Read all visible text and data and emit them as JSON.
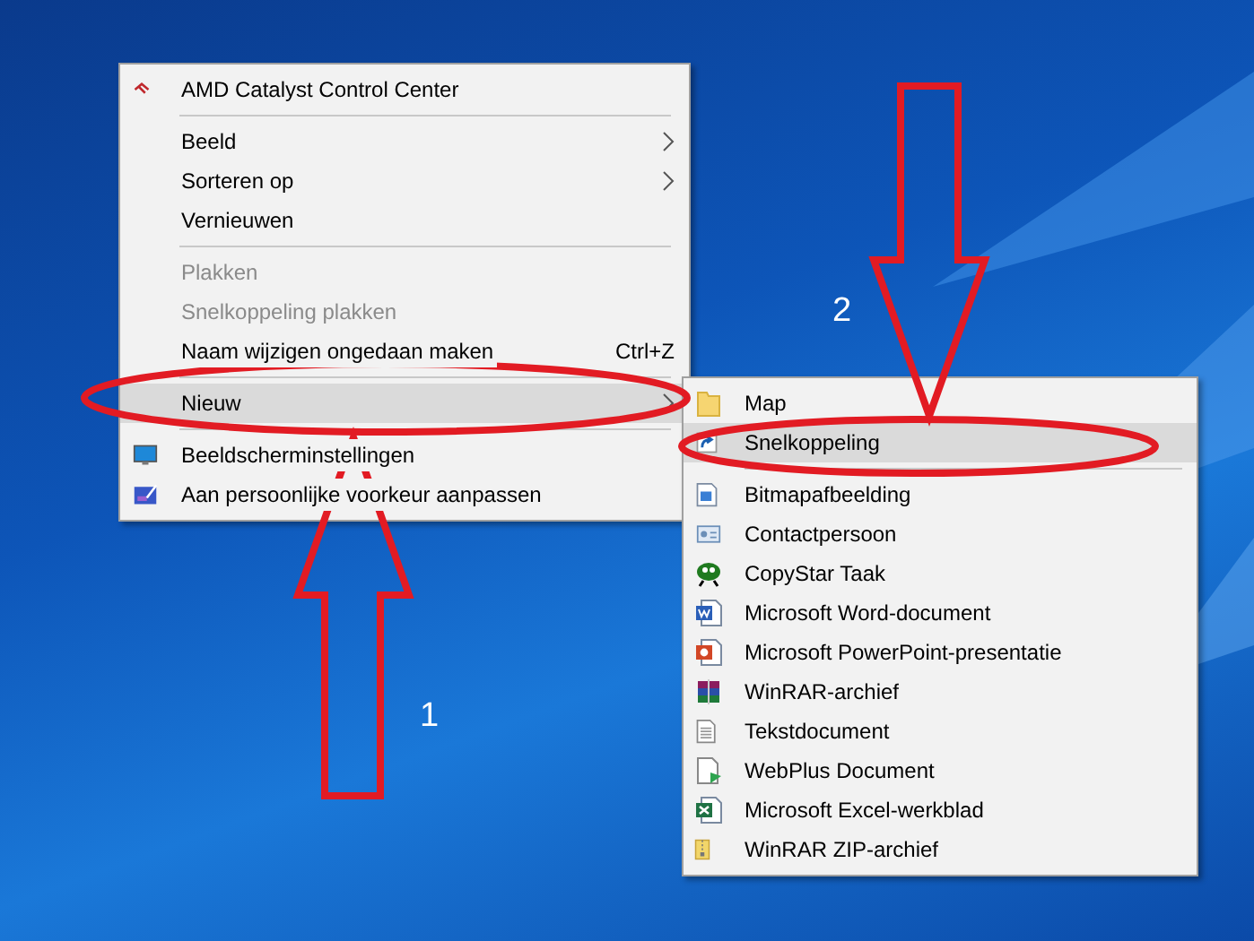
{
  "context_menu": {
    "sections": [
      [
        {
          "label": "AMD Catalyst Control Center",
          "disabled": false,
          "selected": false,
          "has_submenu": false
        }
      ],
      [
        {
          "label": "Beeld",
          "disabled": false,
          "selected": false,
          "has_submenu": true
        },
        {
          "label": "Sorteren op",
          "disabled": false,
          "selected": false,
          "has_submenu": true
        },
        {
          "label": "Vernieuwen",
          "disabled": false,
          "selected": false,
          "has_submenu": false
        }
      ],
      [
        {
          "label": "Plakken",
          "disabled": true,
          "selected": false,
          "has_submenu": false
        },
        {
          "label": "Snelkoppeling plakken",
          "disabled": true,
          "selected": false,
          "has_submenu": false
        },
        {
          "label": "Naam wijzigen ongedaan maken",
          "disabled": false,
          "selected": false,
          "has_submenu": false,
          "shortcut": "Ctrl+Z"
        }
      ],
      [
        {
          "label": "Nieuw",
          "disabled": false,
          "selected": true,
          "has_submenu": true
        }
      ],
      [
        {
          "label": "Beeldscherminstellingen",
          "disabled": false,
          "selected": false,
          "has_submenu": false
        },
        {
          "label": "Aan persoonlijke voorkeur aanpassen",
          "disabled": false,
          "selected": false,
          "has_submenu": false
        }
      ]
    ]
  },
  "submenu": {
    "sections": [
      [
        {
          "label": "Map",
          "selected": false
        },
        {
          "label": "Snelkoppeling",
          "selected": true
        }
      ],
      [
        {
          "label": "Bitmapafbeelding",
          "selected": false
        },
        {
          "label": "Contactpersoon",
          "selected": false
        },
        {
          "label": "CopyStar Taak",
          "selected": false
        },
        {
          "label": "Microsoft Word-document",
          "selected": false
        },
        {
          "label": "Microsoft PowerPoint-presentatie",
          "selected": false
        },
        {
          "label": "WinRAR-archief",
          "selected": false
        },
        {
          "label": "Tekstdocument",
          "selected": false
        },
        {
          "label": "WebPlus Document",
          "selected": false
        },
        {
          "label": "Microsoft Excel-werkblad",
          "selected": false
        },
        {
          "label": "WinRAR ZIP-archief",
          "selected": false
        }
      ]
    ]
  },
  "annotations": [
    {
      "label": "1"
    },
    {
      "label": "2"
    }
  ]
}
